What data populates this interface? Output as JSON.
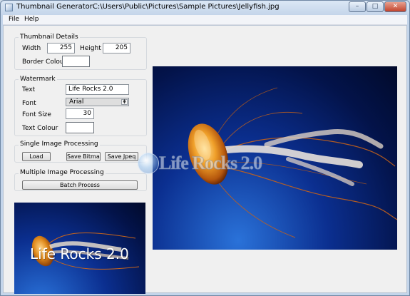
{
  "window": {
    "title": "Thumbnail GeneratorC:\\Users\\Public\\Pictures\\Sample Pictures\\Jellyfish.jpg",
    "minimize_label": "–",
    "maximize_label": "□",
    "close_label": "✕"
  },
  "menu": {
    "file": "File",
    "help": "Help"
  },
  "thumbnail_details": {
    "group_label": "Thumbnail Details",
    "width_label": "Width",
    "width_value": "255",
    "height_label": "Height",
    "height_value": "205",
    "border_colour_label": "Border Colour",
    "border_colour": "#ffffff"
  },
  "watermark": {
    "group_label": "Watermark",
    "text_label": "Text",
    "text_value": "Life Rocks 2.0",
    "font_label": "Font",
    "font_value": "Arial",
    "font_size_label": "Font Size",
    "font_size_value": "30",
    "text_colour_label": "Text Colour",
    "text_colour": "#ffffff"
  },
  "single": {
    "group_label": "Single Image Processing",
    "load": "Load",
    "save_bitmap": "Save Bitmap",
    "save_jpeg": "Save Jpeq"
  },
  "multiple": {
    "group_label": "Multiple Image Processing",
    "batch_process": "Batch Process"
  },
  "thumbnail_preview": {
    "watermark_text": "Life Rocks 2.0"
  },
  "overlay_logo": {
    "text": "Life Rocks 2.0"
  }
}
